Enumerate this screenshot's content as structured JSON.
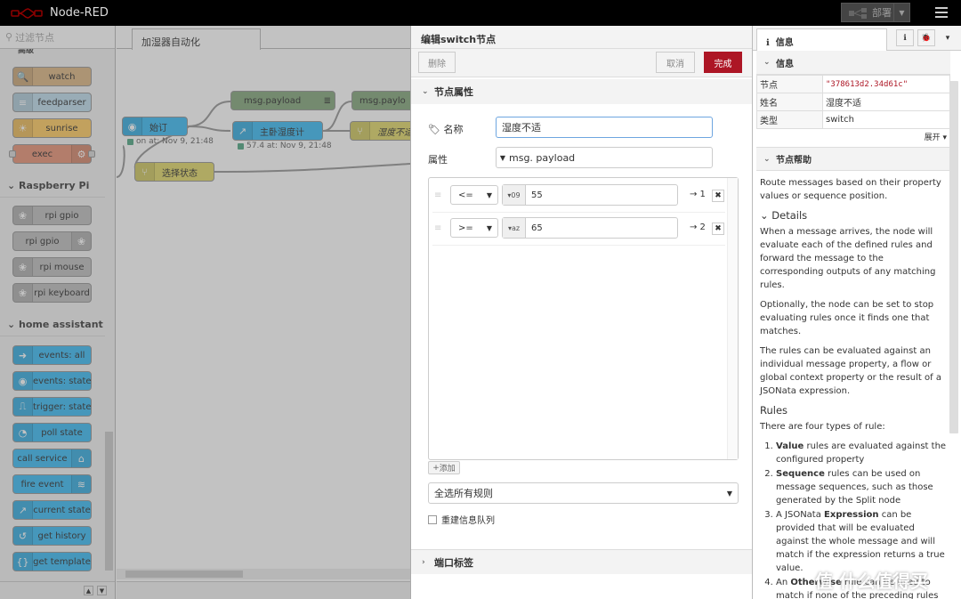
{
  "header": {
    "title": "Node-RED",
    "deploy_label": "部署"
  },
  "palette": {
    "filter_placeholder": "过滤节点",
    "partial_category": "高级",
    "nodes_adv": [
      "watch",
      "feedparser",
      "sunrise",
      "exec"
    ],
    "categories": [
      "Raspberry Pi",
      "home assistant"
    ],
    "nodes_rpi": [
      "rpi gpio",
      "rpi gpio",
      "rpi mouse",
      "rpi keyboard"
    ],
    "nodes_ha": [
      "events: all",
      "events: state",
      "trigger: state",
      "poll state",
      "call service",
      "fire event",
      "current state",
      "get history",
      "get template"
    ]
  },
  "workspace": {
    "tab": "加湿器自动化",
    "nodes": {
      "inject": "始订",
      "switch1": "选择状态",
      "sensor": "主卧湿度计",
      "debug1": "msg.payload",
      "debug2": "msg.paylo",
      "switch2": "湿度不适"
    },
    "status1": "on at: Nov 9, 21:48",
    "status2": "57.4 at: Nov 9, 21:48"
  },
  "editor": {
    "title": "编辑switch节点",
    "delete_label": "删除",
    "cancel_label": "取消",
    "done_label": "完成",
    "section_props": "节点属性",
    "name_label": "名称",
    "name_value": "湿度不适",
    "property_label": "属性",
    "property_value": "msg. payload",
    "rules": [
      {
        "op": "<=",
        "type": "09",
        "value": "55",
        "output": "→ 1"
      },
      {
        "op": ">=",
        "type": "az",
        "value": "65",
        "output": "→ 2"
      }
    ],
    "add_label": "添加",
    "check_mode": "全选所有规则",
    "recreate_label": "重建信息队列",
    "section_ports": "端口标签"
  },
  "sidebar": {
    "tab_label": "信息",
    "info_header": "信息",
    "rows": [
      {
        "k": "节点",
        "v": "\"378613d2.34d61c\""
      },
      {
        "k": "姓名",
        "v": "湿度不适"
      },
      {
        "k": "类型",
        "v": "switch"
      }
    ],
    "expand_label": "展开",
    "help_header": "节点帮助",
    "help_intro": "Route messages based on their property values or sequence position.",
    "details_title": "Details",
    "details_p1": "When a message arrives, the node will evaluate each of the defined rules and forward the message to the corresponding outputs of any matching rules.",
    "details_p2": "Optionally, the node can be set to stop evaluating rules once it finds one that matches.",
    "details_p3": "The rules can be evaluated against an individual message property, a flow or global context property or the result of a JSONata expression.",
    "rules_title": "Rules",
    "rules_intro": "There are four types of rule:",
    "rule_items": [
      {
        "b": "Value",
        "t": " rules are evaluated against the configured property"
      },
      {
        "b": "Sequence",
        "t": " rules can be used on message sequences, such as those generated by the Split node"
      },
      {
        "b": "Expression",
        "p": "A JSONata ",
        "t": " can be provided that will be evaluated against the whole message and will match if the expression returns a true value."
      },
      {
        "b": "Otherwise",
        "p": "An ",
        "t": " rule can be used to match if none of the preceding rules have"
      }
    ]
  },
  "watermark": "值 什么值得买",
  "colors": {
    "header": "#000000",
    "primary": "#ad1625",
    "ha_node": "#41bdf5",
    "watch": "#deb887",
    "feedparser": "#c0deed",
    "sunrise": "#ffcc66",
    "exec": "#e9967a",
    "rpi": "#c0c0c0",
    "function": "#e2d96e",
    "debug": "#87a980"
  }
}
